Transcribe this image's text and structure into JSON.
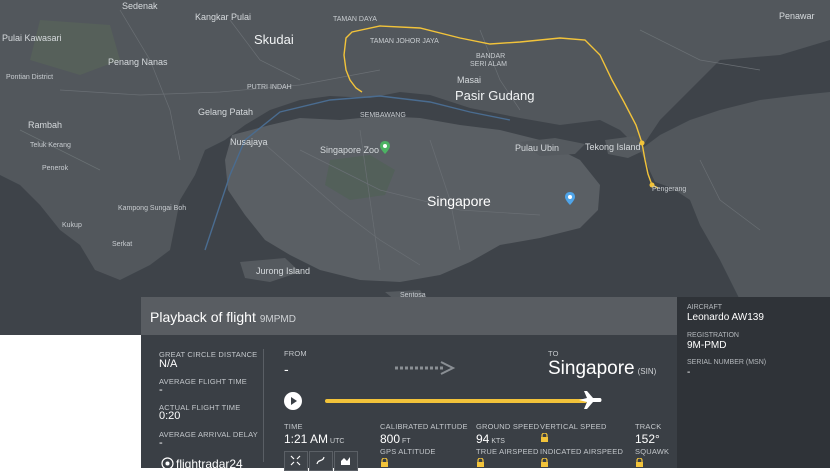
{
  "map": {
    "labels": {
      "sedenak": "Sedenak",
      "kangkar_pulai": "Kangkar Pulai",
      "taman_daya": "TAMAN DAYA",
      "taman_johor_jaya": "TAMAN JOHOR JAYA",
      "pulai_kawasari": "Pulai Kawasari",
      "skudai": "Skudai",
      "penawar": "Penawar",
      "bandar": "BANDAR",
      "seri_alam": "SERI ALAM",
      "masai": "Masai",
      "pontian_district": "Pontian District",
      "penang_nanas": "Penang Nanas",
      "putri_indah": "PUTRI INDAH",
      "pasir_gudang": "Pasir Gudang",
      "rambah": "Rambah",
      "gelang_patah": "Gelang Patah",
      "teluk_kerang": "Teluk Kerang",
      "nusajaya": "Nusajaya",
      "sembawang": "SEMBAWANG",
      "singapore_zoo": "Singapore Zoo",
      "pulau_ubin": "Pulau Ubin",
      "tekong_island": "Tekong Island",
      "penerok": "Penerok",
      "pengerang": "Pengerang",
      "kampong_sungai_boh": "Kampong Sungai Boh",
      "singapore": "Singapore",
      "kukup": "Kukup",
      "serkat": "Serkat",
      "jurong_island": "Jurong Island",
      "sentosa": "Sentosa"
    }
  },
  "panel": {
    "title": "Playback of flight",
    "flight_id": "9MPMD",
    "great_circle_label": "GREAT CIRCLE DISTANCE",
    "great_circle_value": "N/A",
    "avg_flight_time_label": "AVERAGE FLIGHT TIME",
    "avg_flight_time_value": "-",
    "actual_flight_time_label": "ACTUAL FLIGHT TIME",
    "actual_flight_time_value": "0:20",
    "avg_arrival_delay_label": "AVERAGE ARRIVAL DELAY",
    "avg_arrival_delay_value": "-",
    "from_label": "FROM",
    "from_value": "-",
    "to_label": "TO",
    "to_city": "Singapore",
    "to_code": "(SIN)",
    "playback_progress": 0.92,
    "time_label": "TIME",
    "time_value": "1:21 AM",
    "time_unit": "UTC",
    "cal_alt_label": "CALIBRATED ALTITUDE",
    "cal_alt_value": "800",
    "cal_alt_unit": "FT",
    "gps_alt_label": "GPS ALTITUDE",
    "ground_speed_label": "GROUND SPEED",
    "ground_speed_value": "94",
    "ground_speed_unit": "KTS",
    "true_airspeed_label": "TRUE AIRSPEED",
    "vertical_speed_label": "VERTICAL SPEED",
    "indicated_airspeed_label": "INDICATED AIRSPEED",
    "track_label": "TRACK",
    "track_value": "152°",
    "squawk_label": "SQUAWK",
    "logo_text": "flightradar24"
  },
  "aircraft": {
    "aircraft_label": "AIRCRAFT",
    "aircraft_value": "Leonardo AW139",
    "registration_label": "REGISTRATION",
    "registration_value": "9M-PMD",
    "serial_label": "SERIAL NUMBER (MSN)",
    "serial_value": "-"
  },
  "colors": {
    "track_yellow": "#f2c33a",
    "map_land": "#52575c",
    "map_water": "#3e4349",
    "panel_bg": "#3a3f45",
    "header_bg": "#595d62"
  }
}
